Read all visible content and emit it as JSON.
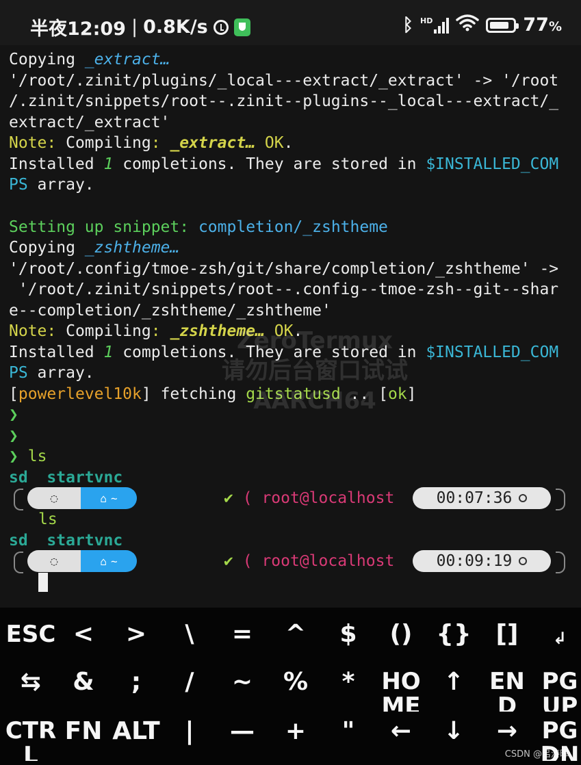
{
  "status": {
    "time": "半夜12:09",
    "speed": "0.8K/s",
    "battery": "77",
    "battery_unit": "%",
    "signal_label": "HD",
    "icons": [
      "alarm-icon",
      "shield-icon",
      "bluetooth-icon",
      "signal-icon",
      "wifi-icon",
      "battery-icon"
    ]
  },
  "terminal": {
    "l1a": "Copying ",
    "l1b": "_extract…",
    "l2": "'/root/.zinit/plugins/_local---extract/_extract' -> '/root",
    "l3": "/.zinit/snippets/root--.zinit--plugins--_local---extract/_",
    "l4": "extract/_extract'",
    "l5a": "Note:",
    "l5b": " Compiling",
    "l5c": ": ",
    "l5d": "_extract…",
    "l5e": " OK",
    "l5f": ".",
    "l6a": "Installed ",
    "l6b": "1",
    "l6c": " completions. They are stored in ",
    "l6d": "$INSTALLED_COM",
    "l7a": "PS",
    "l7b": " array.",
    "l8a": "Setting up snippet: ",
    "l8b": "completion/_zshtheme",
    "l9a": "Copying ",
    "l9b": "_zshtheme…",
    "l10": "'/root/.config/tmoe-zsh/git/share/completion/_zshtheme' ->",
    "l11": " '/root/.zinit/snippets/root--.config--tmoe-zsh--git--shar",
    "l12": "e--completion/_zshtheme/_zshtheme'",
    "l13a": "Note:",
    "l13b": " Compiling",
    "l13c": ": ",
    "l13d": "_zshtheme…",
    "l13e": " OK",
    "l13f": ".",
    "l14a": "Installed ",
    "l14b": "1",
    "l14c": " completions. They are stored in ",
    "l14d": "$INSTALLED_COM",
    "l15a": "PS",
    "l15b": " array.",
    "l16a": "[",
    "l16b": "powerlevel10k",
    "l16c": "] fetching ",
    "l16d": "gitstatusd",
    "l16e": " .. [",
    "l16f": "ok",
    "l16g": "]",
    "prompt_char": "❯",
    "cmd_ls": "ls",
    "ls_out_1": "sd",
    "ls_out_2": "startvnc",
    "check": "✔",
    "paren": "(",
    "userhost": "root@localhost",
    "time_1": "00:07:36",
    "time_2": "00:09:19",
    "seg_home": "~"
  },
  "watermark": {
    "line1": "ZeroTermux",
    "line2": "请勿后台窗口试试",
    "line3": "AARCH64"
  },
  "keyboard": {
    "row1": [
      "ESC",
      "<",
      ">",
      "\\",
      "=",
      "^",
      "$",
      "()",
      "{}",
      "[]",
      "↲"
    ],
    "row2": [
      "⇆",
      "&",
      ";",
      "/",
      "~",
      "%",
      "*",
      "HO ME",
      "↑",
      "EN D",
      "PG UP"
    ],
    "row3": [
      "CTR L",
      "FN",
      "ALT",
      "|",
      "—",
      "+",
      "\"",
      "←",
      "↓",
      "→",
      "PG DN"
    ]
  },
  "footer": {
    "credit": "CSDN @吕涛晖"
  },
  "colors": {
    "yellow": "#d4d44a",
    "blue": "#4cb0e8",
    "green": "#5ccf5c",
    "orange": "#e7a12a",
    "pink": "#d93a76",
    "teal": "#2ba996",
    "segment_blue": "#2aa3ee"
  }
}
